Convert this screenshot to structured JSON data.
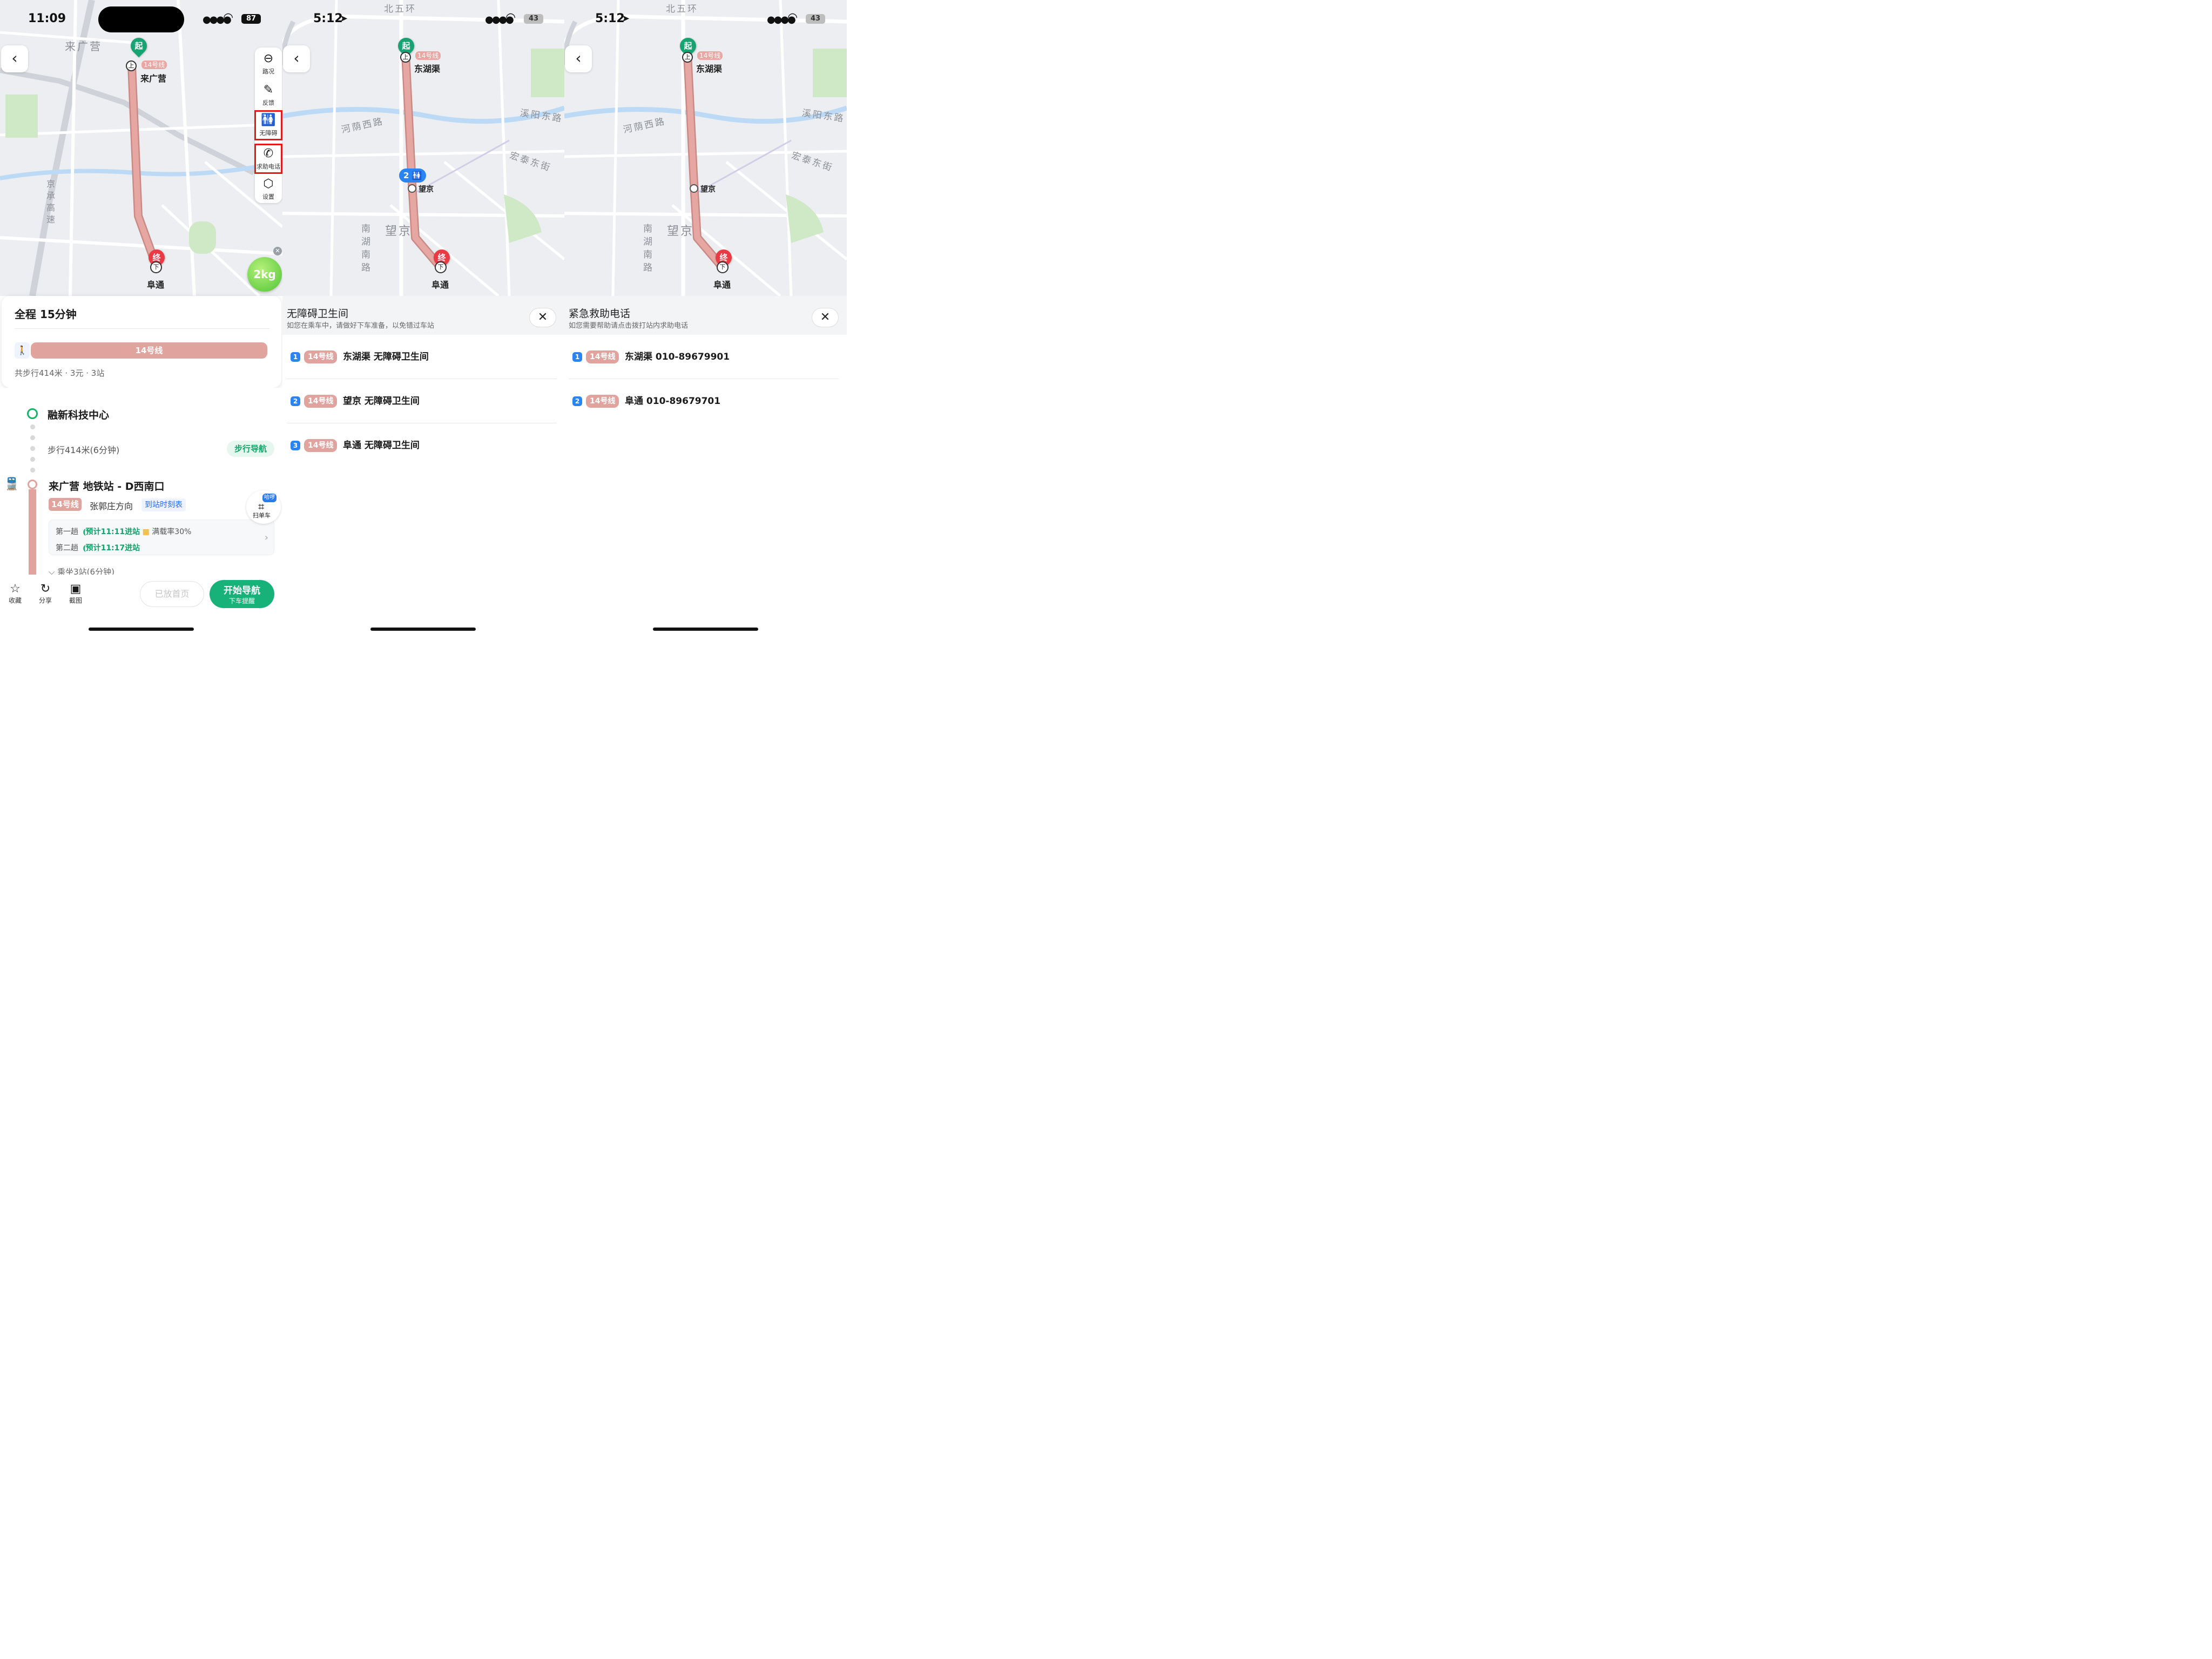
{
  "panel1": {
    "status": {
      "time": "11:09",
      "signal": "●●●●",
      "battery": "87"
    },
    "map": {
      "area_label": "来广营",
      "highway_label": "京承高速",
      "start_badge": "起",
      "end_badge": "终",
      "board_badge": "上",
      "alight_badge": "下",
      "line_tag": "14号线",
      "start_station": "来广营",
      "end_station": "阜通",
      "eco_value": "2kg"
    },
    "toolbar": [
      {
        "label": "路况",
        "icon": "traffic-icon"
      },
      {
        "label": "反馈",
        "icon": "pencil-icon"
      },
      {
        "label": "无障碍",
        "icon": "accessible-restroom-icon"
      },
      {
        "label": "求助电话",
        "icon": "phone-icon"
      },
      {
        "label": "设置",
        "icon": "settings-icon"
      }
    ],
    "summary": {
      "title": "全程  15分钟",
      "line_bar": "14号线",
      "meta": "共步行414米 · 3元 · 3站"
    },
    "route": {
      "origin": "融新科技中心",
      "walk": "步行414米(6分钟)",
      "walk_nav": "步行导航",
      "station": "来广营 地铁站 - D西南口",
      "line_tag": "14号线",
      "direction": "张郭庄方向",
      "schedule": "到站时刻表",
      "train1_label": "第一趟",
      "train1_time": "预计11:11进站",
      "train1_load": "满载率30%",
      "train2_label": "第二趟",
      "train2_time": "预计11:17进站",
      "ride_more": "⌵ 乘坐3站(6分钟)"
    },
    "scan": {
      "badge": "哈啰",
      "label": "扫单车"
    },
    "bottom": {
      "favorite": "收藏",
      "share": "分享",
      "screenshot": "截图",
      "home_btn": "已放首页",
      "nav_main": "开始导航",
      "nav_sub": "下车提醒"
    }
  },
  "panel2": {
    "status": {
      "time": "5:12",
      "battery": "43"
    },
    "map": {
      "road_north": "北五环",
      "road_hy": "河荫西路",
      "road_xy": "溪阳东路",
      "road_ht": "宏泰东街",
      "road_nh": "南湖南路",
      "area": "望京",
      "line_tag": "14号线",
      "start_badge": "起",
      "end_badge": "终",
      "board_badge": "上",
      "alight_badge": "下",
      "station1": "东湖渠",
      "station2": "望京",
      "station3": "阜通",
      "facility_count": "2"
    },
    "sheet": {
      "title": "无障碍卫生间",
      "subtitle": "如您在乘车中，请做好下车准备，以免错过车站",
      "close": "✕",
      "items": [
        {
          "num": "1",
          "line": "14号线",
          "text": "东湖渠 无障碍卫生间"
        },
        {
          "num": "2",
          "line": "14号线",
          "text": "望京 无障碍卫生间"
        },
        {
          "num": "3",
          "line": "14号线",
          "text": "阜通 无障碍卫生间"
        }
      ]
    }
  },
  "panel3": {
    "status": {
      "time": "5:12",
      "battery": "43"
    },
    "map": {
      "road_north": "北五环",
      "road_hy": "河荫西路",
      "road_xy": "溪阳东路",
      "road_ht": "宏泰东街",
      "road_nh": "南湖南路",
      "area": "望京",
      "line_tag": "14号线",
      "start_badge": "起",
      "end_badge": "终",
      "board_badge": "上",
      "alight_badge": "下",
      "station1": "东湖渠",
      "station2": "望京",
      "station3": "阜通"
    },
    "sheet": {
      "title": "紧急救助电话",
      "subtitle": "如您需要帮助请点击拨打站内求助电话",
      "close": "✕",
      "items": [
        {
          "num": "1",
          "line": "14号线",
          "text": "东湖渠 010-89679901"
        },
        {
          "num": "2",
          "line": "14号线",
          "text": "阜通 010-89679701"
        }
      ]
    }
  },
  "colors": {
    "line14": "#e1a39e",
    "accent_green": "#17b17a",
    "start_pin": "#19a373",
    "end_pin": "#ea3b44",
    "highlight_box": "#e01b1b",
    "number_badge": "#2a85f2"
  }
}
